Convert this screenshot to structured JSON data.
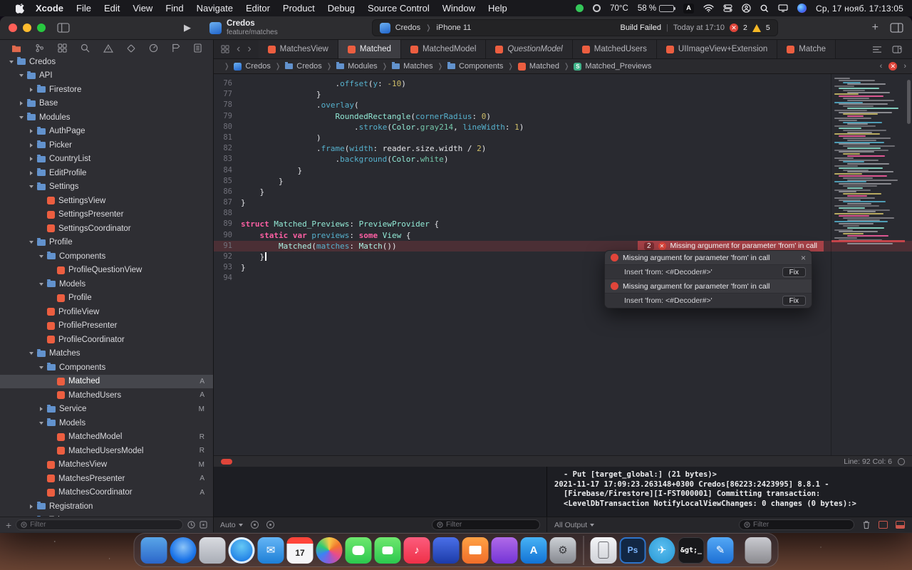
{
  "menu_bar": {
    "items": [
      {
        "label": "Xcode",
        "cls": "bold"
      },
      {
        "label": "File",
        "cls": ""
      },
      {
        "label": "Edit",
        "cls": ""
      },
      {
        "label": "View",
        "cls": ""
      },
      {
        "label": "Find",
        "cls": ""
      },
      {
        "label": "Navigate",
        "cls": ""
      },
      {
        "label": "Editor",
        "cls": ""
      },
      {
        "label": "Product",
        "cls": ""
      },
      {
        "label": "Debug",
        "cls": ""
      },
      {
        "label": "Source Control",
        "cls": ""
      },
      {
        "label": "Window",
        "cls": ""
      },
      {
        "label": "Help",
        "cls": ""
      }
    ],
    "status": {
      "temp": "70°C",
      "battery_pct": "58 %",
      "input_source": "A",
      "clock": "Ср, 17 нояб. 17:13:05"
    }
  },
  "toolbar": {
    "scheme_name": "Credos",
    "scheme_branch": "feature/matches",
    "target": "Credos",
    "device": "iPhone 11",
    "dest_sep": "❭",
    "build_status": "Build Failed",
    "build_bar": "|",
    "build_time": "Today at 17:10",
    "error_count": "2",
    "warning_count": "5",
    "error_glyph": "✕",
    "add_label": "+"
  },
  "tabs": [
    {
      "label": "MatchesView",
      "cls": ""
    },
    {
      "label": "Matched",
      "cls": "active"
    },
    {
      "label": "MatchedModel",
      "cls": ""
    },
    {
      "label": "QuestionModel",
      "cls": "italic"
    },
    {
      "label": "MatchedUsers",
      "cls": ""
    },
    {
      "label": "UIImageView+Extension",
      "cls": ""
    },
    {
      "label": "Matche",
      "cls": ""
    }
  ],
  "breadcrumbs": [
    {
      "label": "Credos",
      "ic": "ic-app",
      "glyph": ""
    },
    {
      "label": "Credos",
      "ic": "ic-folder",
      "glyph": ""
    },
    {
      "label": "Modules",
      "ic": "ic-folder",
      "glyph": ""
    },
    {
      "label": "Matches",
      "ic": "ic-folder",
      "glyph": ""
    },
    {
      "label": "Components",
      "ic": "ic-folder",
      "glyph": ""
    },
    {
      "label": "Matched",
      "ic": "ic-swift",
      "glyph": ""
    },
    {
      "label": "Matched_Previews",
      "ic": "ic-struct",
      "glyph": "S"
    }
  ],
  "crumb_sep": "❭",
  "sidebar": {
    "filter_placeholder": "Filter",
    "items": [
      {
        "label": "Credos",
        "cls": "lv1",
        "icon": "i-folder",
        "disc": "d-open"
      },
      {
        "label": "API",
        "cls": "lv2",
        "icon": "i-folder",
        "disc": "d-open"
      },
      {
        "label": "Firestore",
        "cls": "lv3",
        "icon": "i-folder",
        "disc": "d-closed"
      },
      {
        "label": "Base",
        "cls": "lv2",
        "icon": "i-folder",
        "disc": "d-closed"
      },
      {
        "label": "Modules",
        "cls": "lv2",
        "icon": "i-folder",
        "disc": "d-open"
      },
      {
        "label": "AuthPage",
        "cls": "lv3",
        "icon": "i-folder",
        "disc": "d-closed"
      },
      {
        "label": "Picker",
        "cls": "lv3",
        "icon": "i-folder",
        "disc": "d-closed"
      },
      {
        "label": "CountryList",
        "cls": "lv3",
        "icon": "i-folder",
        "disc": "d-closed"
      },
      {
        "label": "EditProfile",
        "cls": "lv3",
        "icon": "i-folder",
        "disc": "d-closed"
      },
      {
        "label": "Settings",
        "cls": "lv3",
        "icon": "i-folder",
        "disc": "d-open"
      },
      {
        "label": "SettingsView",
        "cls": "lv4",
        "icon": "i-swift",
        "disc": "d-none"
      },
      {
        "label": "SettingsPresenter",
        "cls": "lv4",
        "icon": "i-swift",
        "disc": "d-none"
      },
      {
        "label": "SettingsCoordinator",
        "cls": "lv4",
        "icon": "i-swift",
        "disc": "d-none"
      },
      {
        "label": "Profile",
        "cls": "lv3",
        "icon": "i-folder",
        "disc": "d-open"
      },
      {
        "label": "Components",
        "cls": "lv4",
        "icon": "i-folder",
        "disc": "d-open"
      },
      {
        "label": "ProfileQuestionView",
        "cls": "lv5",
        "icon": "i-swift",
        "disc": "d-none"
      },
      {
        "label": "Models",
        "cls": "lv4",
        "icon": "i-folder",
        "disc": "d-open"
      },
      {
        "label": "Profile",
        "cls": "lv5",
        "icon": "i-swift",
        "disc": "d-none"
      },
      {
        "label": "ProfileView",
        "cls": "lv4",
        "icon": "i-swift",
        "disc": "d-none"
      },
      {
        "label": "ProfilePresenter",
        "cls": "lv4",
        "icon": "i-swift",
        "disc": "d-none"
      },
      {
        "label": "ProfileCoordinator",
        "cls": "lv4",
        "icon": "i-swift",
        "disc": "d-none"
      },
      {
        "label": "Matches",
        "cls": "lv3",
        "icon": "i-folder",
        "disc": "d-open"
      },
      {
        "label": "Components",
        "cls": "lv4",
        "icon": "i-folder",
        "disc": "d-open"
      },
      {
        "label": "Matched",
        "cls": "lv5 selected",
        "icon": "i-swift",
        "disc": "d-none",
        "badge": "A"
      },
      {
        "label": "MatchedUsers",
        "cls": "lv5",
        "icon": "i-swift",
        "disc": "d-none",
        "badge": "A"
      },
      {
        "label": "Service",
        "cls": "lv4",
        "icon": "i-folder",
        "disc": "d-closed",
        "badge": "M"
      },
      {
        "label": "Models",
        "cls": "lv4",
        "icon": "i-folder",
        "disc": "d-open"
      },
      {
        "label": "MatchedModel",
        "cls": "lv5",
        "icon": "i-swift",
        "disc": "d-none",
        "badge": "R"
      },
      {
        "label": "MatchedUsersModel",
        "cls": "lv5",
        "icon": "i-swift",
        "disc": "d-none",
        "badge": "R"
      },
      {
        "label": "MatchesView",
        "cls": "lv4",
        "icon": "i-swift",
        "disc": "d-none",
        "badge": "M"
      },
      {
        "label": "MatchesPresenter",
        "cls": "lv4",
        "icon": "i-swift",
        "disc": "d-none",
        "badge": "A"
      },
      {
        "label": "MatchesCoordinator",
        "cls": "lv4",
        "icon": "i-swift",
        "disc": "d-none",
        "badge": "A"
      },
      {
        "label": "Registration",
        "cls": "lv3",
        "icon": "i-folder",
        "disc": "d-closed"
      },
      {
        "label": "Tab",
        "cls": "lv3",
        "icon": "i-folder",
        "disc": "d-closed"
      }
    ]
  },
  "editor": {
    "lines": [
      {
        "n": 76,
        "t": [
          [
            "p",
            "                    ."
          ],
          [
            "f",
            "offset"
          ],
          [
            "p",
            "("
          ],
          [
            "f",
            "y"
          ],
          [
            "p",
            ": "
          ],
          [
            "n",
            "-10"
          ],
          [
            "p",
            ")"
          ]
        ]
      },
      {
        "n": 77,
        "t": [
          [
            "p",
            "                }"
          ]
        ]
      },
      {
        "n": 78,
        "t": [
          [
            "p",
            "                ."
          ],
          [
            "f",
            "overlay"
          ],
          [
            "p",
            "("
          ]
        ]
      },
      {
        "n": 79,
        "t": [
          [
            "p",
            "                    "
          ],
          [
            "t",
            "RoundedRectangle"
          ],
          [
            "p",
            "("
          ],
          [
            "f",
            "cornerRadius"
          ],
          [
            "p",
            ": "
          ],
          [
            "n",
            "0"
          ],
          [
            "p",
            ")"
          ]
        ]
      },
      {
        "n": 80,
        "t": [
          [
            "p",
            "                        ."
          ],
          [
            "f",
            "stroke"
          ],
          [
            "p",
            "("
          ],
          [
            "t",
            "Color"
          ],
          [
            "p",
            "."
          ],
          [
            "pr",
            "gray214"
          ],
          [
            "p",
            ", "
          ],
          [
            "f",
            "lineWidth"
          ],
          [
            "p",
            ": "
          ],
          [
            "n",
            "1"
          ],
          [
            "p",
            ")"
          ]
        ]
      },
      {
        "n": 81,
        "t": [
          [
            "p",
            "                )"
          ]
        ]
      },
      {
        "n": 82,
        "t": [
          [
            "p",
            "                ."
          ],
          [
            "f",
            "frame"
          ],
          [
            "p",
            "("
          ],
          [
            "f",
            "width"
          ],
          [
            "p",
            ": reader.size.width / "
          ],
          [
            "n",
            "2"
          ],
          [
            "p",
            ")"
          ]
        ]
      },
      {
        "n": 83,
        "t": [
          [
            "p",
            "                    ."
          ],
          [
            "f",
            "background"
          ],
          [
            "p",
            "("
          ],
          [
            "t",
            "Color"
          ],
          [
            "p",
            "."
          ],
          [
            "pr",
            "white"
          ],
          [
            "p",
            ")"
          ]
        ]
      },
      {
        "n": 84,
        "t": [
          [
            "p",
            "            }"
          ]
        ]
      },
      {
        "n": 85,
        "t": [
          [
            "p",
            "        }"
          ]
        ]
      },
      {
        "n": 86,
        "t": [
          [
            "p",
            "    }"
          ]
        ]
      },
      {
        "n": 87,
        "t": [
          [
            "p",
            "}"
          ]
        ]
      },
      {
        "n": 88,
        "t": []
      },
      {
        "n": 89,
        "t": [
          [
            "k",
            "struct"
          ],
          [
            "p",
            " "
          ],
          [
            "t",
            "Matched_Previews"
          ],
          [
            "p",
            ": "
          ],
          [
            "t",
            "PreviewProvider"
          ],
          [
            "p",
            " {"
          ]
        ]
      },
      {
        "n": 90,
        "t": [
          [
            "p",
            "    "
          ],
          [
            "k",
            "static"
          ],
          [
            "p",
            " "
          ],
          [
            "k",
            "var"
          ],
          [
            "p",
            " "
          ],
          [
            "f",
            "previews"
          ],
          [
            "p",
            ": "
          ],
          [
            "k",
            "some"
          ],
          [
            "p",
            " "
          ],
          [
            "t",
            "View"
          ],
          [
            "p",
            " {"
          ]
        ]
      },
      {
        "n": 91,
        "err": true,
        "t": [
          [
            "p",
            "        "
          ],
          [
            "pt",
            "Matched"
          ],
          [
            "p",
            "("
          ],
          [
            "f",
            "matches"
          ],
          [
            "p",
            ": "
          ],
          [
            "pt",
            "Match"
          ],
          [
            "p",
            "())"
          ]
        ]
      },
      {
        "n": 92,
        "cursor": true,
        "t": [
          [
            "p",
            "    }"
          ]
        ]
      },
      {
        "n": 93,
        "t": [
          [
            "p",
            "}"
          ]
        ]
      },
      {
        "n": 94,
        "t": []
      }
    ],
    "error_banner": {
      "count": "2",
      "glyph": "✕",
      "text": "Missing argument for parameter 'from' in call"
    },
    "status": {
      "line_col": "Line: 92 Col: 6"
    }
  },
  "popup": {
    "rows": [
      {
        "cls": "error",
        "text": "Missing argument for parameter 'from' in call",
        "close": "×"
      },
      {
        "cls": "fix",
        "text": "Insert 'from: <#Decoder#>'",
        "button": "Fix"
      },
      {
        "cls": "error",
        "text": "Missing argument for parameter 'from' in call"
      },
      {
        "cls": "fix",
        "text": "Insert 'from: <#Decoder#>'",
        "button": "Fix"
      }
    ]
  },
  "console": {
    "lines": [
      {
        "cls": "ind1",
        "text": "- Put [target_global:] (21 bytes)>"
      },
      {
        "cls": "",
        "text": "2021-11-17 17:09:23.263148+0300 Credos[86223:2423995] 8.8.1 -"
      },
      {
        "cls": "ind1",
        "text": "[Firebase/Firestore][I-FST000001] Committing transaction:"
      },
      {
        "cls": "ind1",
        "text": "<LevelDbTransaction NotifyLocalViewChanges: 0 changes (0 bytes):>"
      }
    ]
  },
  "debug_bar": {
    "auto_label": "Auto",
    "all_output_label": "All Output",
    "filter_placeholder": "Filter"
  },
  "dock": {
    "items": [
      {
        "name": "finder",
        "cls": "dk-finder",
        "glyph": ""
      },
      {
        "name": "browser",
        "cls": "dk-browser round",
        "glyph": ""
      },
      {
        "name": "launchpad",
        "cls": "dk-launchpad",
        "glyph": ""
      },
      {
        "name": "safari",
        "cls": "dk-safari round",
        "glyph": ""
      },
      {
        "name": "mail",
        "cls": "dk-mail",
        "glyph": "✉"
      },
      {
        "name": "calendar",
        "cls": "dk-calendar",
        "glyph": "17"
      },
      {
        "name": "photos",
        "cls": "dk-photos round",
        "glyph": ""
      },
      {
        "name": "messages",
        "cls": "dk-messages",
        "glyph": ""
      },
      {
        "name": "facetime",
        "cls": "dk-facetime",
        "glyph": ""
      },
      {
        "name": "music",
        "cls": "dk-music",
        "glyph": "♪"
      },
      {
        "name": "xcode",
        "cls": "dk-xcode",
        "glyph": ""
      },
      {
        "name": "books",
        "cls": "dk-books",
        "glyph": ""
      },
      {
        "name": "podcasts",
        "cls": "dk-podcasts",
        "glyph": ""
      },
      {
        "name": "app-store",
        "cls": "dk-appstore",
        "glyph": "A"
      },
      {
        "name": "system-preferences",
        "cls": "dk-settings",
        "glyph": "⚙"
      },
      {
        "name": "simulator",
        "cls": "dk-simulator after-sep",
        "glyph": ""
      },
      {
        "name": "graphics-app",
        "cls": "dk-graphics",
        "glyph": "Ps"
      },
      {
        "name": "telegram",
        "cls": "dk-telegram round",
        "glyph": "✈"
      },
      {
        "name": "terminal",
        "cls": "dk-terminal",
        "glyph": "&gt;_"
      },
      {
        "name": "notes-app",
        "cls": "dk-notes",
        "glyph": "✎"
      },
      {
        "name": "trash",
        "cls": "dk-trash trash-gap",
        "glyph": ""
      }
    ]
  }
}
